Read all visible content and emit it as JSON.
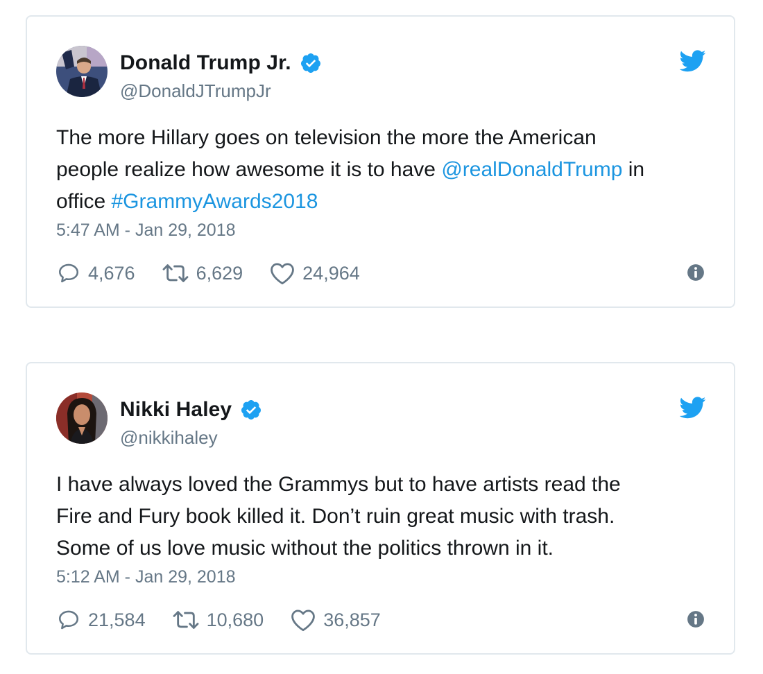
{
  "colors": {
    "brand_blue": "#1da1f2",
    "link_blue": "#1b95e0",
    "text_primary": "#14171a",
    "text_secondary": "#657786",
    "border": "#e1e8ed"
  },
  "tweets": [
    {
      "display_name": "Donald Trump Jr.",
      "handle": "@DonaldJTrumpJr",
      "verified": true,
      "avatar_icon": "avatar-photo",
      "text_lines": [
        [
          {
            "t": "The more Hillary goes on television the more the American"
          }
        ],
        [
          {
            "t": "people realize how awesome it is to have "
          },
          {
            "t": "@realDonaldTrump",
            "link": true
          },
          {
            "t": " in"
          }
        ],
        [
          {
            "t": "office "
          },
          {
            "t": "#GrammyAwards2018",
            "link": true
          }
        ]
      ],
      "timestamp": "5:47 AM - Jan 29, 2018",
      "replies": "4,676",
      "retweets": "6,629",
      "likes": "24,964"
    },
    {
      "display_name": "Nikki Haley",
      "handle": "@nikkihaley",
      "verified": true,
      "avatar_icon": "avatar-photo",
      "text_lines": [
        [
          {
            "t": "I have always loved the Grammys but to have artists read the"
          }
        ],
        [
          {
            "t": "Fire and Fury book killed it. Don’t ruin great music with trash."
          }
        ],
        [
          {
            "t": "Some of us love music without the politics thrown in it."
          }
        ]
      ],
      "timestamp": "5:12 AM - Jan 29, 2018",
      "replies": "21,584",
      "retweets": "10,680",
      "likes": "36,857"
    }
  ]
}
